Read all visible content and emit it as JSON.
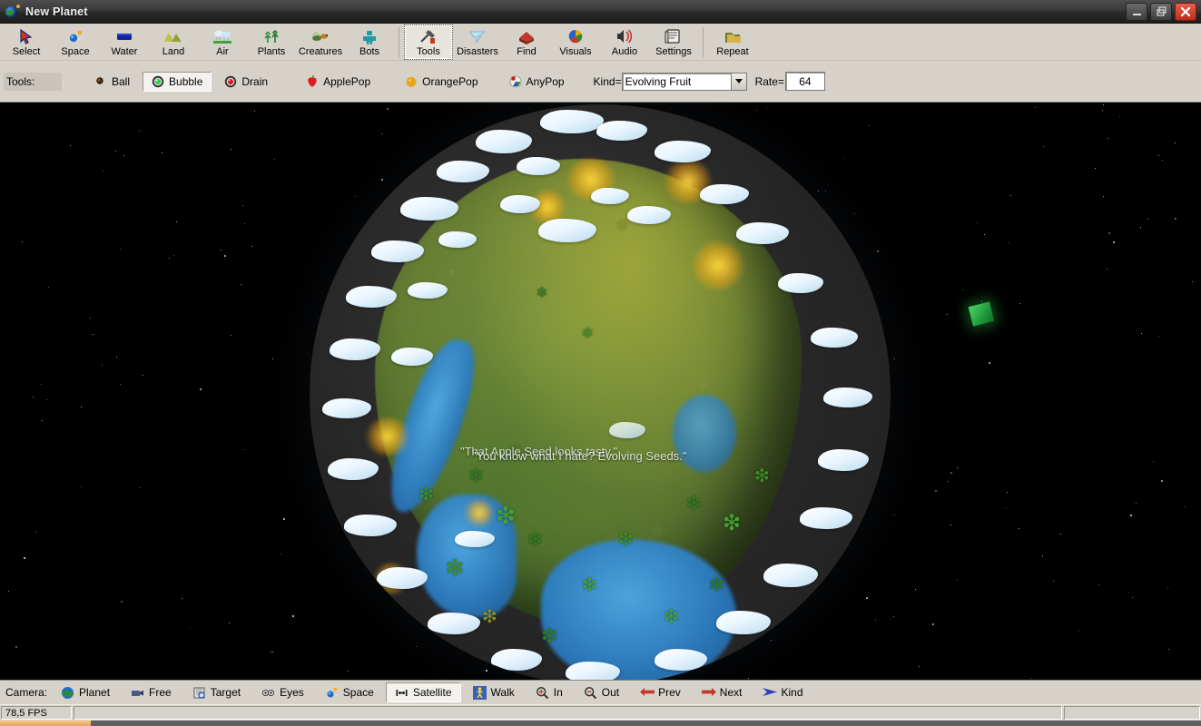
{
  "window": {
    "title": "New Planet",
    "icon": "planet-globe-icon",
    "buttons": {
      "minimize": "minimize-icon",
      "restore": "restore-icon",
      "close": "close-icon"
    }
  },
  "ribbon": {
    "items": [
      {
        "label": "Select",
        "icon": "arrow-cursor-icon",
        "selected": false
      },
      {
        "label": "Space",
        "icon": "space-sparkle-icon",
        "selected": false
      },
      {
        "label": "Water",
        "icon": "water-tray-icon",
        "selected": false
      },
      {
        "label": "Land",
        "icon": "land-hills-icon",
        "selected": false
      },
      {
        "label": "Air",
        "icon": "air-clouds-icon",
        "selected": false
      },
      {
        "label": "Plants",
        "icon": "plants-trees-icon",
        "selected": false
      },
      {
        "label": "Creatures",
        "icon": "creature-icon",
        "selected": false
      },
      {
        "label": "Bots",
        "icon": "robot-icon",
        "selected": false
      },
      {
        "label": "Tools",
        "icon": "tools-hammer-icon",
        "selected": true
      },
      {
        "label": "Disasters",
        "icon": "tornado-icon",
        "selected": false
      },
      {
        "label": "Find",
        "icon": "find-book-icon",
        "selected": false
      },
      {
        "label": "Visuals",
        "icon": "visuals-palette-icon",
        "selected": false
      },
      {
        "label": "Audio",
        "icon": "speaker-icon",
        "selected": false
      },
      {
        "label": "Settings",
        "icon": "settings-panel-icon",
        "selected": false
      },
      {
        "label": "Repeat",
        "icon": "repeat-folder-icon",
        "selected": false
      }
    ]
  },
  "tools_bar": {
    "label": "Tools:",
    "options": [
      {
        "label": "Ball",
        "icon": "ball-icon",
        "color": "#5a3a1a",
        "selected": false
      },
      {
        "label": "Bubble",
        "icon": "bubble-icon",
        "color": "#2ecc40",
        "selected": true
      },
      {
        "label": "Drain",
        "icon": "drain-icon",
        "color": "#d4151a",
        "selected": false
      },
      {
        "label": "ApplePop",
        "icon": "apple-icon",
        "color": "#e01b1b",
        "selected": false
      },
      {
        "label": "OrangePop",
        "icon": "orange-icon",
        "color": "#e8a317",
        "selected": false
      },
      {
        "label": "AnyPop",
        "icon": "anypop-icon",
        "color": "#cfcfcf",
        "selected": false
      }
    ],
    "kind_label": "Kind=",
    "kind_value": "Evolving Fruit",
    "rate_label": "Rate=",
    "rate_value": "64"
  },
  "viewport": {
    "speech_lines": [
      "\"That Apple Seed looks tasty.\"",
      "\"You know what I hate? Evolving Seeds.\""
    ],
    "objects": {
      "satellite": "green-cube-satellite"
    }
  },
  "camera_bar": {
    "label": "Camera:",
    "buttons": [
      {
        "label": "Planet",
        "icon": "globe-icon",
        "selected": false
      },
      {
        "label": "Free",
        "icon": "free-camera-icon",
        "selected": false
      },
      {
        "label": "Target",
        "icon": "target-camera-icon",
        "selected": false
      },
      {
        "label": "Eyes",
        "icon": "eyes-icon",
        "selected": false
      },
      {
        "label": "Space",
        "icon": "space-icon",
        "selected": false
      },
      {
        "label": "Satellite",
        "icon": "satellite-icon",
        "selected": true
      },
      {
        "label": "Walk",
        "icon": "walk-icon",
        "selected": false
      },
      {
        "label": "In",
        "icon": "zoom-in-icon",
        "selected": false
      },
      {
        "label": "Out",
        "icon": "zoom-out-icon",
        "selected": false
      },
      {
        "label": "Prev",
        "icon": "arrow-left-icon",
        "selected": false
      },
      {
        "label": "Next",
        "icon": "arrow-right-icon",
        "selected": false
      },
      {
        "label": "Kind",
        "icon": "kind-arrow-icon",
        "selected": false
      }
    ]
  },
  "status_bar": {
    "fps": "78,5 FPS",
    "middle": "",
    "right": ""
  },
  "colors": {
    "chrome": "#d6d2ca",
    "titlebar": "#2a2a2a",
    "close": "#c8321e",
    "space": "#000000",
    "land": "#6b8238",
    "water": "#2e7fc4",
    "cloud": "#eaf6ff",
    "satellite": "#2ecc40",
    "taskbar_active": "#e8a357"
  }
}
